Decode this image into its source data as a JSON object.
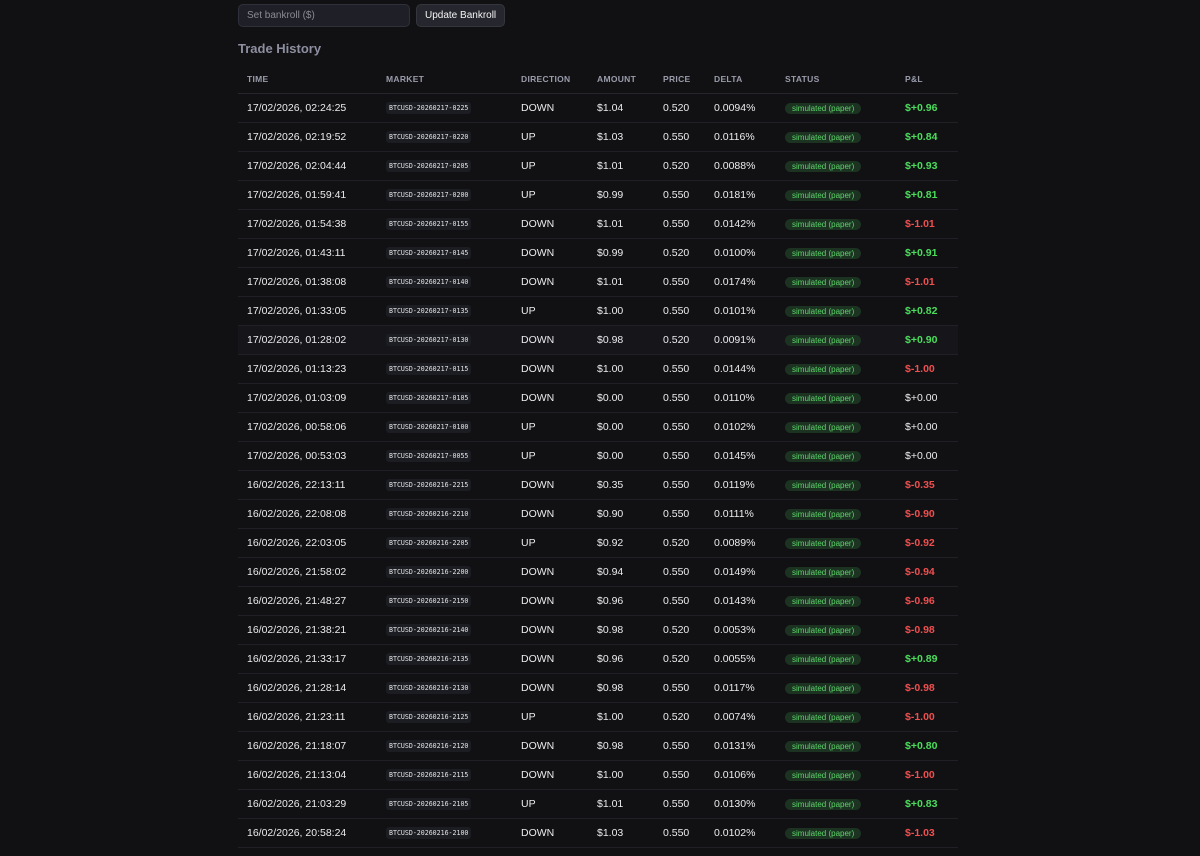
{
  "bankroll": {
    "placeholder": "Set bankroll ($)",
    "value": "",
    "update_label": "Update Bankroll"
  },
  "section_title": "Trade History",
  "columns": [
    "TIME",
    "MARKET",
    "DIRECTION",
    "AMOUNT",
    "PRICE",
    "DELTA",
    "STATUS",
    "P&L"
  ],
  "colors": {
    "background": "#111114",
    "positive": "#4ade5b",
    "negative": "#ef4f4f",
    "status_text": "#5ed46b",
    "status_bg": "#1c3322"
  },
  "trades": [
    {
      "time": "17/02/2026, 02:24:25",
      "market": "BTCUSD-20260217-0225",
      "direction": "DOWN",
      "amount": "$1.04",
      "price": "0.520",
      "delta": "0.0094%",
      "status": "simulated (paper)",
      "pnl": "$+0.96",
      "pnl_sign": "pos"
    },
    {
      "time": "17/02/2026, 02:19:52",
      "market": "BTCUSD-20260217-0220",
      "direction": "UP",
      "amount": "$1.03",
      "price": "0.550",
      "delta": "0.0116%",
      "status": "simulated (paper)",
      "pnl": "$+0.84",
      "pnl_sign": "pos"
    },
    {
      "time": "17/02/2026, 02:04:44",
      "market": "BTCUSD-20260217-0205",
      "direction": "UP",
      "amount": "$1.01",
      "price": "0.520",
      "delta": "0.0088%",
      "status": "simulated (paper)",
      "pnl": "$+0.93",
      "pnl_sign": "pos"
    },
    {
      "time": "17/02/2026, 01:59:41",
      "market": "BTCUSD-20260217-0200",
      "direction": "UP",
      "amount": "$0.99",
      "price": "0.550",
      "delta": "0.0181%",
      "status": "simulated (paper)",
      "pnl": "$+0.81",
      "pnl_sign": "pos"
    },
    {
      "time": "17/02/2026, 01:54:38",
      "market": "BTCUSD-20260217-0155",
      "direction": "DOWN",
      "amount": "$1.01",
      "price": "0.550",
      "delta": "0.0142%",
      "status": "simulated (paper)",
      "pnl": "$-1.01",
      "pnl_sign": "neg"
    },
    {
      "time": "17/02/2026, 01:43:11",
      "market": "BTCUSD-20260217-0145",
      "direction": "DOWN",
      "amount": "$0.99",
      "price": "0.520",
      "delta": "0.0100%",
      "status": "simulated (paper)",
      "pnl": "$+0.91",
      "pnl_sign": "pos"
    },
    {
      "time": "17/02/2026, 01:38:08",
      "market": "BTCUSD-20260217-0140",
      "direction": "DOWN",
      "amount": "$1.01",
      "price": "0.550",
      "delta": "0.0174%",
      "status": "simulated (paper)",
      "pnl": "$-1.01",
      "pnl_sign": "neg"
    },
    {
      "time": "17/02/2026, 01:33:05",
      "market": "BTCUSD-20260217-0135",
      "direction": "UP",
      "amount": "$1.00",
      "price": "0.550",
      "delta": "0.0101%",
      "status": "simulated (paper)",
      "pnl": "$+0.82",
      "pnl_sign": "pos"
    },
    {
      "time": "17/02/2026, 01:28:02",
      "market": "BTCUSD-20260217-0130",
      "direction": "DOWN",
      "amount": "$0.98",
      "price": "0.520",
      "delta": "0.0091%",
      "status": "simulated (paper)",
      "pnl": "$+0.90",
      "pnl_sign": "pos"
    },
    {
      "time": "17/02/2026, 01:13:23",
      "market": "BTCUSD-20260217-0115",
      "direction": "DOWN",
      "amount": "$1.00",
      "price": "0.550",
      "delta": "0.0144%",
      "status": "simulated (paper)",
      "pnl": "$-1.00",
      "pnl_sign": "neg"
    },
    {
      "time": "17/02/2026, 01:03:09",
      "market": "BTCUSD-20260217-0105",
      "direction": "DOWN",
      "amount": "$0.00",
      "price": "0.550",
      "delta": "0.0110%",
      "status": "simulated (paper)",
      "pnl": "$+0.00",
      "pnl_sign": "zero"
    },
    {
      "time": "17/02/2026, 00:58:06",
      "market": "BTCUSD-20260217-0100",
      "direction": "UP",
      "amount": "$0.00",
      "price": "0.550",
      "delta": "0.0102%",
      "status": "simulated (paper)",
      "pnl": "$+0.00",
      "pnl_sign": "zero"
    },
    {
      "time": "17/02/2026, 00:53:03",
      "market": "BTCUSD-20260217-0055",
      "direction": "UP",
      "amount": "$0.00",
      "price": "0.550",
      "delta": "0.0145%",
      "status": "simulated (paper)",
      "pnl": "$+0.00",
      "pnl_sign": "zero"
    },
    {
      "time": "16/02/2026, 22:13:11",
      "market": "BTCUSD-20260216-2215",
      "direction": "DOWN",
      "amount": "$0.35",
      "price": "0.550",
      "delta": "0.0119%",
      "status": "simulated (paper)",
      "pnl": "$-0.35",
      "pnl_sign": "neg"
    },
    {
      "time": "16/02/2026, 22:08:08",
      "market": "BTCUSD-20260216-2210",
      "direction": "DOWN",
      "amount": "$0.90",
      "price": "0.550",
      "delta": "0.0111%",
      "status": "simulated (paper)",
      "pnl": "$-0.90",
      "pnl_sign": "neg"
    },
    {
      "time": "16/02/2026, 22:03:05",
      "market": "BTCUSD-20260216-2205",
      "direction": "UP",
      "amount": "$0.92",
      "price": "0.520",
      "delta": "0.0089%",
      "status": "simulated (paper)",
      "pnl": "$-0.92",
      "pnl_sign": "neg"
    },
    {
      "time": "16/02/2026, 21:58:02",
      "market": "BTCUSD-20260216-2200",
      "direction": "DOWN",
      "amount": "$0.94",
      "price": "0.550",
      "delta": "0.0149%",
      "status": "simulated (paper)",
      "pnl": "$-0.94",
      "pnl_sign": "neg"
    },
    {
      "time": "16/02/2026, 21:48:27",
      "market": "BTCUSD-20260216-2150",
      "direction": "DOWN",
      "amount": "$0.96",
      "price": "0.550",
      "delta": "0.0143%",
      "status": "simulated (paper)",
      "pnl": "$-0.96",
      "pnl_sign": "neg"
    },
    {
      "time": "16/02/2026, 21:38:21",
      "market": "BTCUSD-20260216-2140",
      "direction": "DOWN",
      "amount": "$0.98",
      "price": "0.520",
      "delta": "0.0053%",
      "status": "simulated (paper)",
      "pnl": "$-0.98",
      "pnl_sign": "neg"
    },
    {
      "time": "16/02/2026, 21:33:17",
      "market": "BTCUSD-20260216-2135",
      "direction": "DOWN",
      "amount": "$0.96",
      "price": "0.520",
      "delta": "0.0055%",
      "status": "simulated (paper)",
      "pnl": "$+0.89",
      "pnl_sign": "pos"
    },
    {
      "time": "16/02/2026, 21:28:14",
      "market": "BTCUSD-20260216-2130",
      "direction": "DOWN",
      "amount": "$0.98",
      "price": "0.550",
      "delta": "0.0117%",
      "status": "simulated (paper)",
      "pnl": "$-0.98",
      "pnl_sign": "neg"
    },
    {
      "time": "16/02/2026, 21:23:11",
      "market": "BTCUSD-20260216-2125",
      "direction": "UP",
      "amount": "$1.00",
      "price": "0.520",
      "delta": "0.0074%",
      "status": "simulated (paper)",
      "pnl": "$-1.00",
      "pnl_sign": "neg"
    },
    {
      "time": "16/02/2026, 21:18:07",
      "market": "BTCUSD-20260216-2120",
      "direction": "DOWN",
      "amount": "$0.98",
      "price": "0.550",
      "delta": "0.0131%",
      "status": "simulated (paper)",
      "pnl": "$+0.80",
      "pnl_sign": "pos"
    },
    {
      "time": "16/02/2026, 21:13:04",
      "market": "BTCUSD-20260216-2115",
      "direction": "DOWN",
      "amount": "$1.00",
      "price": "0.550",
      "delta": "0.0106%",
      "status": "simulated (paper)",
      "pnl": "$-1.00",
      "pnl_sign": "neg"
    },
    {
      "time": "16/02/2026, 21:03:29",
      "market": "BTCUSD-20260216-2105",
      "direction": "UP",
      "amount": "$1.01",
      "price": "0.550",
      "delta": "0.0130%",
      "status": "simulated (paper)",
      "pnl": "$+0.83",
      "pnl_sign": "pos"
    },
    {
      "time": "16/02/2026, 20:58:24",
      "market": "BTCUSD-20260216-2100",
      "direction": "DOWN",
      "amount": "$1.03",
      "price": "0.550",
      "delta": "0.0102%",
      "status": "simulated (paper)",
      "pnl": "$-1.03",
      "pnl_sign": "neg"
    }
  ]
}
